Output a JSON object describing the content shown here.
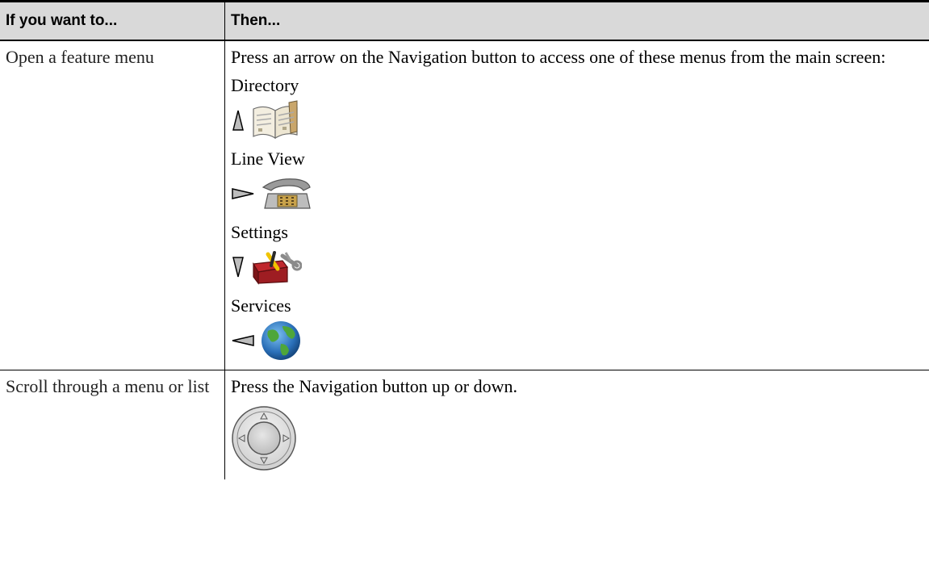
{
  "table": {
    "header": {
      "col1": "If you want to...",
      "col2": "Then..."
    },
    "rows": [
      {
        "action": "Open a feature menu",
        "instruction": "Press an arrow on the Navigation button to access one of these menus from the main screen:",
        "menus": [
          {
            "label": "Directory",
            "arrow": "up-arrow-icon",
            "icon": "directory-book-icon"
          },
          {
            "label": "Line View",
            "arrow": "right-arrow-icon",
            "icon": "line-view-phone-icon"
          },
          {
            "label": "Settings",
            "arrow": "down-arrow-icon",
            "icon": "settings-toolbox-icon"
          },
          {
            "label": "Services",
            "arrow": "left-arrow-icon",
            "icon": "services-globe-icon"
          }
        ]
      },
      {
        "action": "Scroll through a menu or list",
        "instruction": "Press the Navigation button up or down.",
        "icon": "navigation-button-icon"
      }
    ]
  },
  "colors": {
    "header_background": "#d9d9d9",
    "rule": "#000000"
  }
}
